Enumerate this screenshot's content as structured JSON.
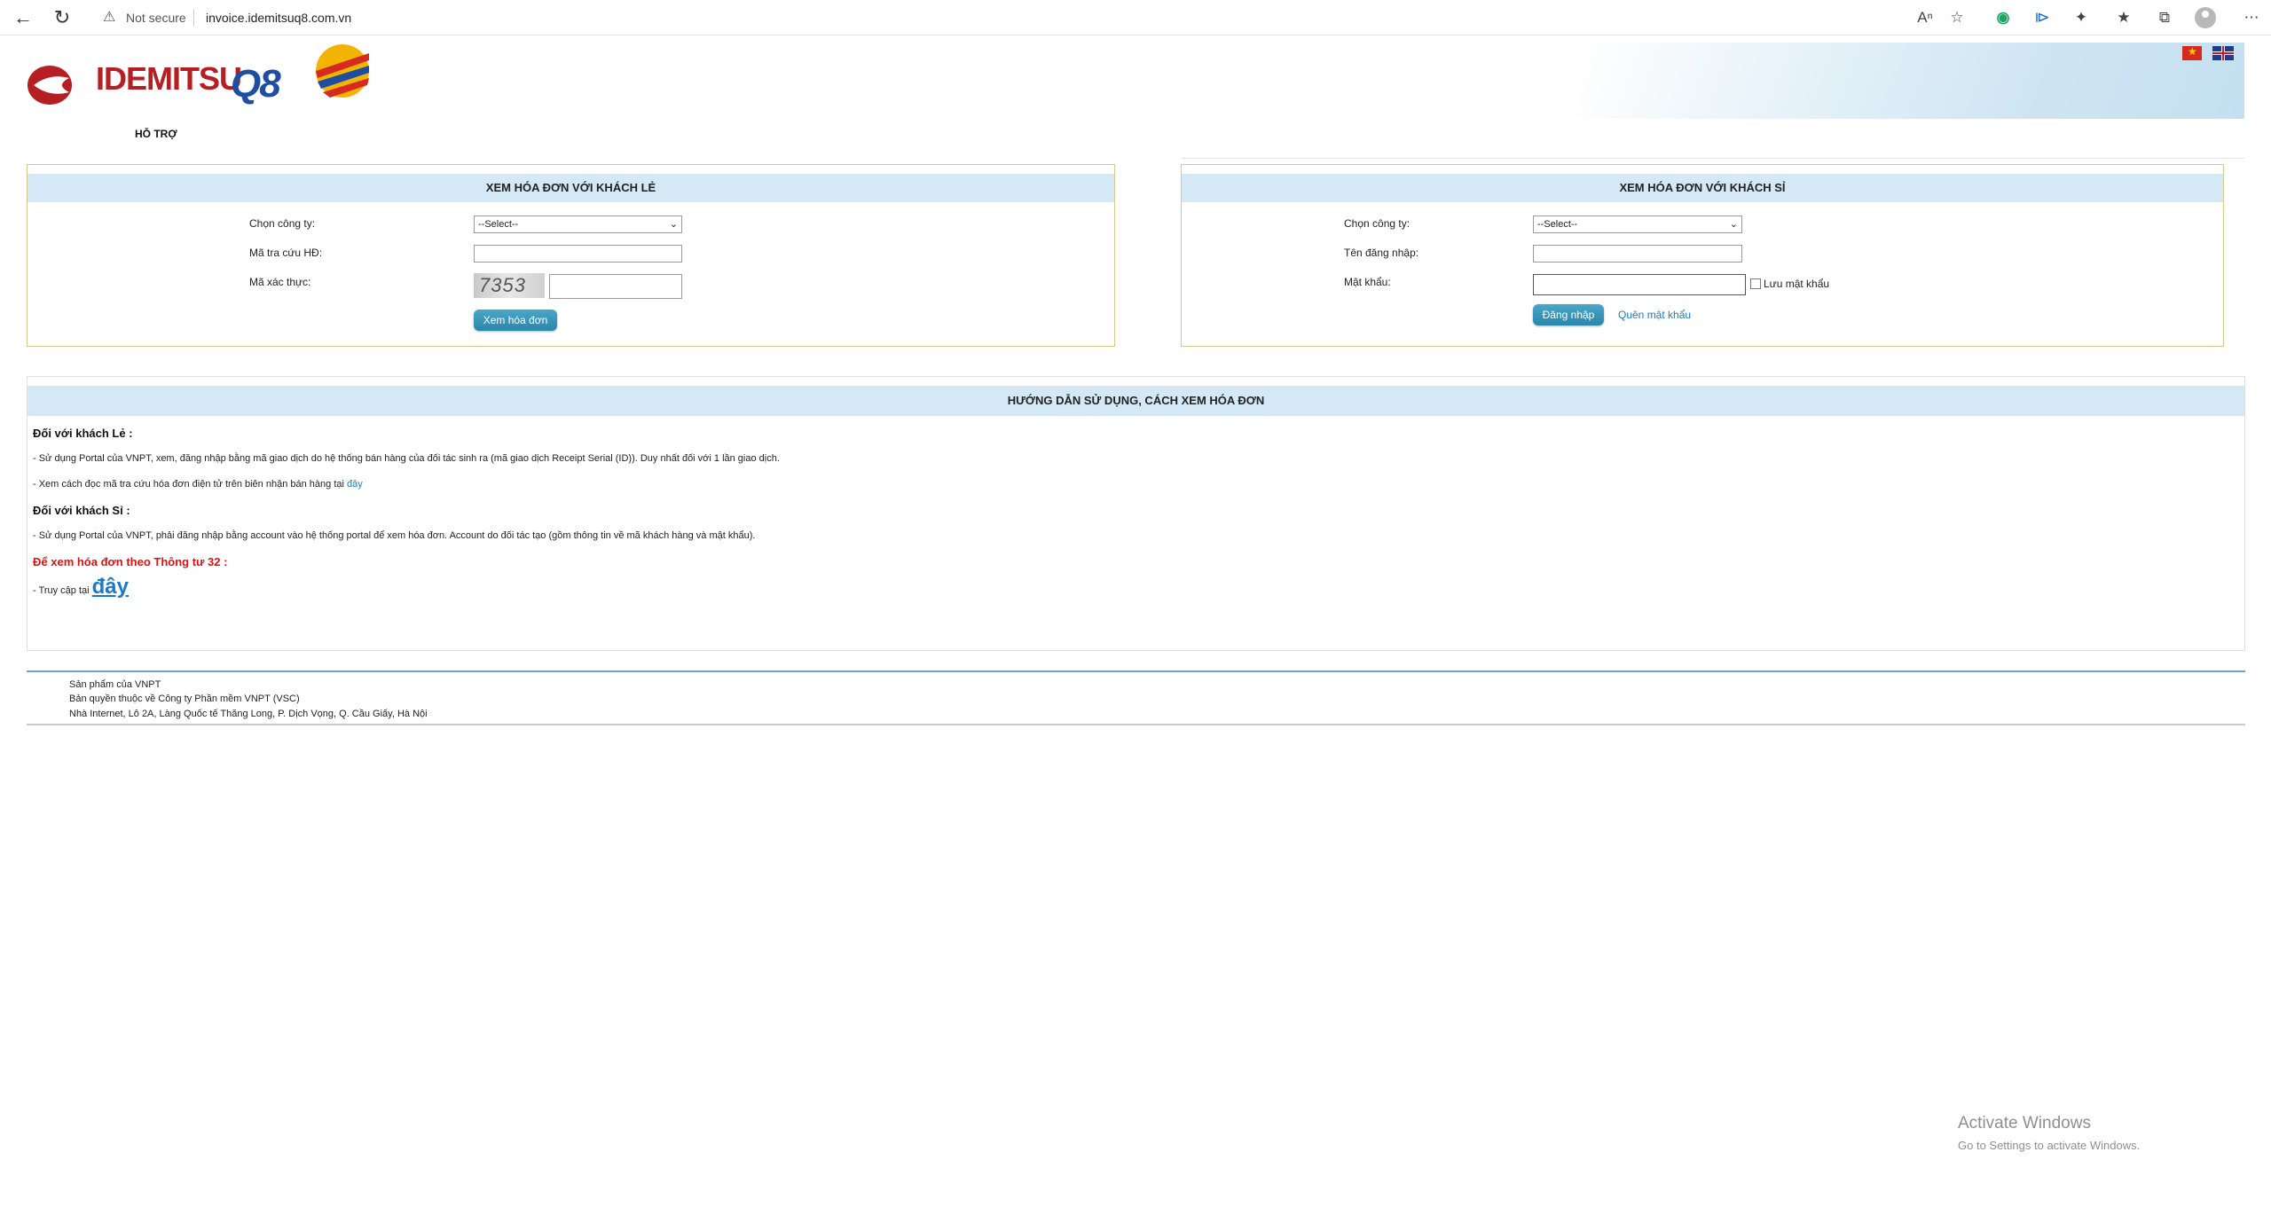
{
  "browser": {
    "back_icon": "back-arrow-icon",
    "refresh_icon": "refresh-icon",
    "security_label": "Not secure",
    "url": "invoice.idemitsuq8.com.vn"
  },
  "header": {
    "logo_text": "IDEMITSU",
    "logo_q8": "Q8",
    "support_link": "HỖ TRỢ"
  },
  "retail": {
    "title": "XEM HÓA ĐƠN VỚI KHÁCH LẺ",
    "company_label": "Chọn công ty:",
    "company_value": "--Select--",
    "lookup_label": "Mã tra cứu HĐ:",
    "lookup_value": "",
    "captcha_label": "Mã xác thực:",
    "captcha_text": "7353",
    "captcha_value": "",
    "view_button": "Xem hóa đơn"
  },
  "wholesale": {
    "title": "XEM HÓA ĐƠN VỚI KHÁCH SỈ",
    "company_label": "Chọn công ty:",
    "company_value": "--Select--",
    "username_label": "Tên đăng nhập:",
    "username_value": "",
    "password_label": "Mật khẩu:",
    "password_value": "",
    "remember_label": "Lưu mật khẩu",
    "login_button": "Đăng nhập",
    "forgot_link": "Quên mật khẩu"
  },
  "guide": {
    "title": "HƯỚNG DẪN SỬ DỤNG, CÁCH XEM HÓA ĐƠN",
    "retail_heading": "Đối với khách Lẻ :",
    "retail_line1": "- Sử dụng Portal của VNPT, xem, đăng nhập bằng mã giao dịch do hệ thống bán hàng của đối tác sinh ra (mã giao dịch Receipt Serial (ID)). Duy nhất đối với 1 lần giao dịch.",
    "retail_line2": "- Xem cách đọc mã tra cứu hóa đơn điện tử trên biên nhận bán hàng tại",
    "retail_line2_link": "đây",
    "wholesale_heading": "Đối với khách Sỉ :",
    "wholesale_line1": "- Sử dụng Portal của VNPT, phải đăng nhập bằng account vào hệ thống portal để xem hóa đơn. Account do đối tác tạo (gồm thông tin về mã khách hàng và mật khẩu).",
    "circular_heading": "Để xem hóa đơn theo Thông tư 32 :",
    "access_text": "- Truy cập tại",
    "access_link": "đây"
  },
  "footer": {
    "line1": "Sản phẩm của VNPT",
    "line2": "Bản quyền thuộc về Công ty Phần mềm VNPT (VSC)",
    "line3": "Nhà Internet, Lô 2A, Làng Quốc tế Thăng Long, P. Dịch Vọng, Q. Cầu Giấy, Hà Nội"
  },
  "windows": {
    "title": "Activate Windows",
    "subtitle": "Go to Settings to activate Windows."
  }
}
